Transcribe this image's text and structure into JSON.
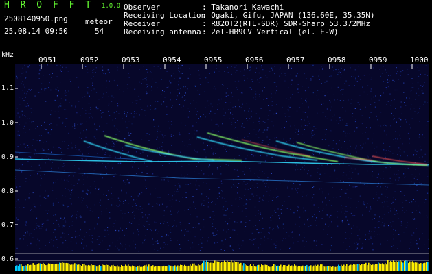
{
  "app": {
    "title_letters": "H R O F F T",
    "version": "1.0.0",
    "filename": "2508140950.png",
    "meteor_label": "meteor",
    "timestamp": "25.08.14 09:50",
    "meteor_count": "54"
  },
  "info": {
    "rows": [
      {
        "label": "Observer",
        "value": ": Takanori Kawachi"
      },
      {
        "label": "Receiving Location",
        "value": ": Ogaki, Gifu, JAPAN (136.60E, 35.35N)"
      },
      {
        "label": "Receiver",
        "value": ": R820T2(RTL-SDR) SDR-Sharp 53.372MHz"
      },
      {
        "label": "Receiving antenna",
        "value": ": 2el-HB9CV Vertical (el. E-W)"
      }
    ]
  },
  "axis": {
    "y_unit": "kHz",
    "y_ticks": [
      "1.1",
      "1.0",
      "0.9",
      "0.8",
      "0.7",
      "0.6"
    ],
    "x_ticks": [
      "0951",
      "0952",
      "0953",
      "0954",
      "0955",
      "0956",
      "0957",
      "0958",
      "0959",
      "1000"
    ]
  },
  "colors": {
    "background": "#000000",
    "spectrogram_bg": "#07072a",
    "header_green": "#66ff33",
    "signal_cyan": "#33ddff",
    "signal_green": "#88ff66",
    "signal_red": "#ff5555",
    "bottom_bar_yellow": "#ffee00",
    "bottom_bar_cyan": "#00ccff"
  }
}
